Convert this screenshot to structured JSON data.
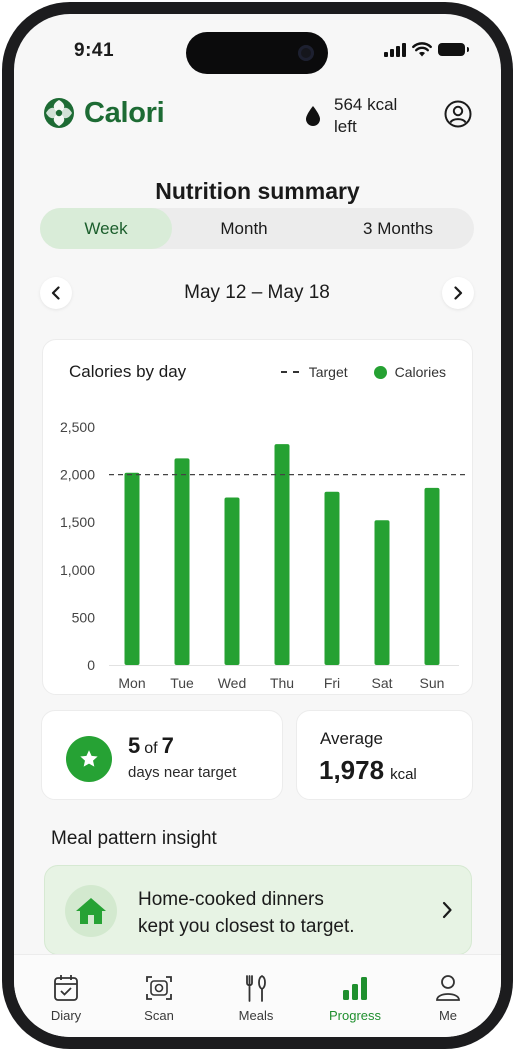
{
  "status_bar": {
    "time": "9:41"
  },
  "header": {
    "app_name": "Calori",
    "kcal_left": "564 kcal left"
  },
  "page_title": "Nutrition summary",
  "period_tabs": [
    {
      "label": "Week",
      "active": true
    },
    {
      "label": "Month",
      "active": false
    },
    {
      "label": "3 Months",
      "active": false
    }
  ],
  "date_range": "May 12 – May 18",
  "chart_data": {
    "type": "bar",
    "title": "Calories by day",
    "categories": [
      "Mon",
      "Tue",
      "Wed",
      "Thu",
      "Fri",
      "Sat",
      "Sun"
    ],
    "values": [
      2020,
      2170,
      1760,
      2320,
      1820,
      1520,
      1860
    ],
    "series": [
      {
        "name": "Calories",
        "values": [
          2020,
          2170,
          1760,
          2320,
          1820,
          1520,
          1860
        ]
      }
    ],
    "target": 2000,
    "target_label": "Target",
    "y_ticks": [
      "0",
      "500",
      "1,000",
      "1,500",
      "2,000",
      "2,500"
    ],
    "ylim": [
      0,
      2500
    ],
    "legend_position": "top-right",
    "bar_color": "#25a132",
    "grid": false
  },
  "stats": {
    "near_target_count": "5",
    "near_target_of": "of",
    "near_target_total": "7",
    "near_target_label": "days near target",
    "average_label": "Average",
    "average_value": "1,978",
    "average_unit": "kcal"
  },
  "insight": {
    "section_title": "Meal pattern insight",
    "line1": "Home-cooked dinners",
    "line2": "kept you closest to target."
  },
  "bottom_nav": [
    {
      "label": "Diary",
      "icon": "calendar-icon",
      "active": false
    },
    {
      "label": "Scan",
      "icon": "scan-icon",
      "active": false
    },
    {
      "label": "Meals",
      "icon": "utensils-icon",
      "active": false
    },
    {
      "label": "Progress",
      "icon": "bar-chart-icon",
      "active": true
    },
    {
      "label": "Me",
      "icon": "person-icon",
      "active": false
    }
  ],
  "colors": {
    "brand": "#1d6b34",
    "accent": "#25a132",
    "tab_active_bg": "#d9ecd8",
    "insight_bg": "#e7f3e4"
  }
}
